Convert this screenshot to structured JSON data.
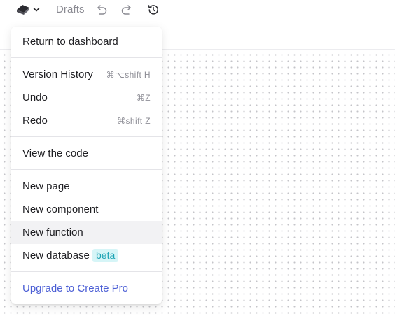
{
  "topbar": {
    "logo_icon": "app-logo-icon",
    "caret_icon": "chevron-down-icon",
    "breadcrumb": "Drafts",
    "undo_icon": "undo-icon",
    "redo_icon": "redo-icon",
    "history_icon": "history-icon"
  },
  "menu": {
    "return_dashboard": "Return to dashboard",
    "version_history": {
      "label": "Version History",
      "shortcut": "⌘⌥shift H"
    },
    "undo": {
      "label": "Undo",
      "shortcut": "⌘Z"
    },
    "redo": {
      "label": "Redo",
      "shortcut": "⌘shift Z"
    },
    "view_code": "View the code",
    "new_page": "New page",
    "new_component": "New component",
    "new_function": "New function",
    "new_database": {
      "label": "New database",
      "badge": "beta"
    },
    "upgrade": "Upgrade to Create Pro"
  },
  "colors": {
    "accent": "#4c5fd5",
    "badge_bg": "#d6f5f7",
    "badge_text": "#1aa2b3",
    "hover_bg": "#f2f2f4"
  }
}
